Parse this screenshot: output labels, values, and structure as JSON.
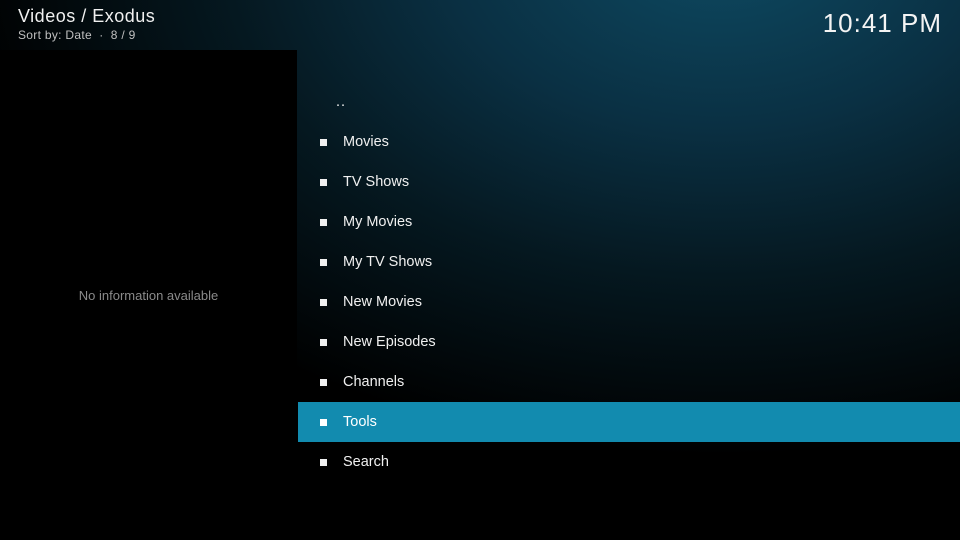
{
  "header": {
    "breadcrumb": "Videos / Exodus",
    "sort_label": "Sort by: Date",
    "position": "8 / 9",
    "separator": "·"
  },
  "clock": "10:41 PM",
  "sidebar": {
    "info_text": "No information available"
  },
  "list": {
    "up_label": "..",
    "items": [
      {
        "label": "Movies"
      },
      {
        "label": "TV Shows"
      },
      {
        "label": "My Movies"
      },
      {
        "label": "My TV Shows"
      },
      {
        "label": "New Movies"
      },
      {
        "label": "New Episodes"
      },
      {
        "label": "Channels"
      },
      {
        "label": "Tools",
        "selected": true
      },
      {
        "label": "Search"
      }
    ]
  }
}
